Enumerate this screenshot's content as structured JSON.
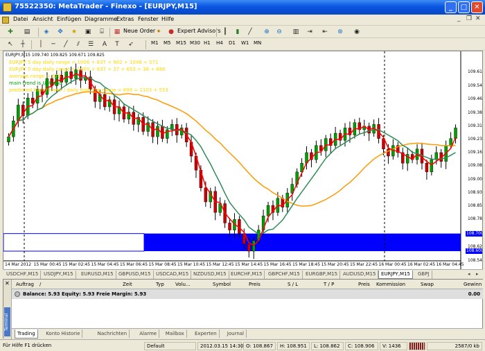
{
  "window": {
    "title": "75522350: MetaTrader - Finexo - [EURJPY,M15]"
  },
  "menu": [
    "Datei",
    "Ansicht",
    "Einfügen",
    "Diagramme",
    "Extras",
    "Fenster",
    "Hilfe"
  ],
  "toolbar": {
    "new_order": "Neue Order",
    "expert_advisors": "Expert Advisors"
  },
  "timeframes": [
    "M1",
    "M5",
    "M15",
    "M30",
    "H1",
    "H4",
    "D1",
    "W1",
    "MN"
  ],
  "chart": {
    "info": "EURJPY,M15  109.740 109.825 109.671 109.825",
    "annotations": [
      {
        "text": "EURJPY 5 day daily range = 1006 + 837 + 902 + 1048 + 571",
        "color": "#ffd700"
      },
      {
        "text": "EURJPY 5 day daily range = 1000 + 837 + 37 + 653 + 38 + 680",
        "color": "#ffd700"
      },
      {
        "text": "average range = 873",
        "color": "#ffd700"
      },
      {
        "text": "main trend is Uptrend",
        "color": "#00a000"
      },
      {
        "text": "predicted high / lower / daily high  low range = 899 = 1103 + 553",
        "color": "#ffd700"
      }
    ],
    "price_labels": [
      "109.615",
      "109.540",
      "109.465",
      "109.385",
      "109.310",
      "109.235",
      "109.160",
      "109.085",
      "109.005",
      "108.930",
      "108.855",
      "108.780",
      "108.700",
      "108.625",
      "108.545"
    ],
    "highlight_prices": [
      "108.700",
      "108.600"
    ],
    "time_labels": [
      "14 Mar 2012",
      "15 Mar 00:45",
      "15 Mar 02:45",
      "15 Mar 04:45",
      "15 Mar 06:45",
      "15 Mar 08:45",
      "15 Mar 10:45",
      "15 Mar 12:45",
      "15 Mar 14:45",
      "15 Mar 16:45",
      "15 Mar 18:45",
      "15 Mar 20:45",
      "15 Mar 22:45",
      "16 Mar 00:45",
      "16 Mar 02:45",
      "16 Mar 04:45"
    ],
    "colors": {
      "bull": "#00a000",
      "bear": "#d00000",
      "ma_fast": "#ff0000",
      "ma_mid": "#2e8b57",
      "ma_slow": "#ff9900",
      "zone": "#0000ff"
    }
  },
  "chart_data": {
    "type": "candlestick",
    "symbol": "EURJPY",
    "timeframe": "M15",
    "ylim": [
      108.545,
      109.68
    ],
    "closes": [
      109.25,
      109.34,
      109.43,
      109.37,
      109.47,
      109.44,
      109.52,
      109.49,
      109.58,
      109.54,
      109.6,
      109.56,
      109.62,
      109.58,
      109.63,
      109.57,
      109.59,
      109.52,
      109.45,
      109.49,
      109.42,
      109.46,
      109.38,
      109.42,
      109.35,
      109.39,
      109.32,
      109.36,
      109.28,
      109.33,
      109.25,
      109.31,
      109.24,
      109.29,
      109.32,
      109.26,
      109.3,
      109.22,
      109.14,
      109.06,
      108.96,
      108.88,
      108.94,
      108.82,
      108.87,
      108.76,
      108.72,
      108.78,
      108.7,
      108.64,
      108.6,
      108.66,
      108.72,
      108.8,
      108.86,
      108.82,
      108.9,
      108.85,
      108.93,
      108.98,
      109.05,
      109.1,
      109.16,
      109.12,
      109.2,
      109.17,
      109.24,
      109.2,
      109.27,
      109.23,
      109.3,
      109.26,
      109.33,
      109.29,
      109.31,
      109.27,
      109.32,
      109.24,
      109.18,
      109.14,
      109.2,
      109.16,
      109.1,
      109.15,
      109.12,
      109.18,
      109.1,
      109.05,
      109.12,
      109.16,
      109.11,
      109.2,
      109.24,
      109.3
    ],
    "series": [
      {
        "name": "fast MA"
      },
      {
        "name": "mid MA"
      },
      {
        "name": "slow MA"
      }
    ],
    "zones": [
      {
        "from": 108.6,
        "to": 108.7
      }
    ]
  },
  "symbol_tabs": [
    "USDCHF,M15",
    "USDJPY,M15",
    "EURUSD,M15",
    "GBPUSD,M15",
    "USDCAD,M15",
    "NZDUSD,M15",
    "EURCHF,M15",
    "GBPCHF,M15",
    "EURGBP,M15",
    "AUDUSD,M15",
    "EURJPY,M15",
    "GBPJ"
  ],
  "active_symbol_tab": "EURJPY,M15",
  "terminal": {
    "side_label": "Terminal",
    "columns": [
      "Auftrag",
      "/",
      "Zeit",
      "Typ",
      "Volu...",
      "Symbol",
      "Preis",
      "S / L",
      "T / P",
      "Preis",
      "Kommission",
      "Swap",
      "Gewinn"
    ],
    "balance_text": "Balance: 5.93  Equity: 5.93  Freie Margin: 5.93",
    "balance_value": "0.00",
    "tabs": [
      "Trading",
      "Konto Historie",
      "Nachrichten",
      "Alarme",
      "Mailbox",
      "Experten",
      "Journal"
    ]
  },
  "status": {
    "help": "Für Hilfe F1 drücken",
    "profile": "Default",
    "datetime": "2012.03.15 14:30",
    "open": "O: 108.867",
    "high": "H: 108.951",
    "low": "L: 108.862",
    "close": "C: 108.906",
    "volume": "V: 1436",
    "traffic": "2587/0 kb"
  }
}
